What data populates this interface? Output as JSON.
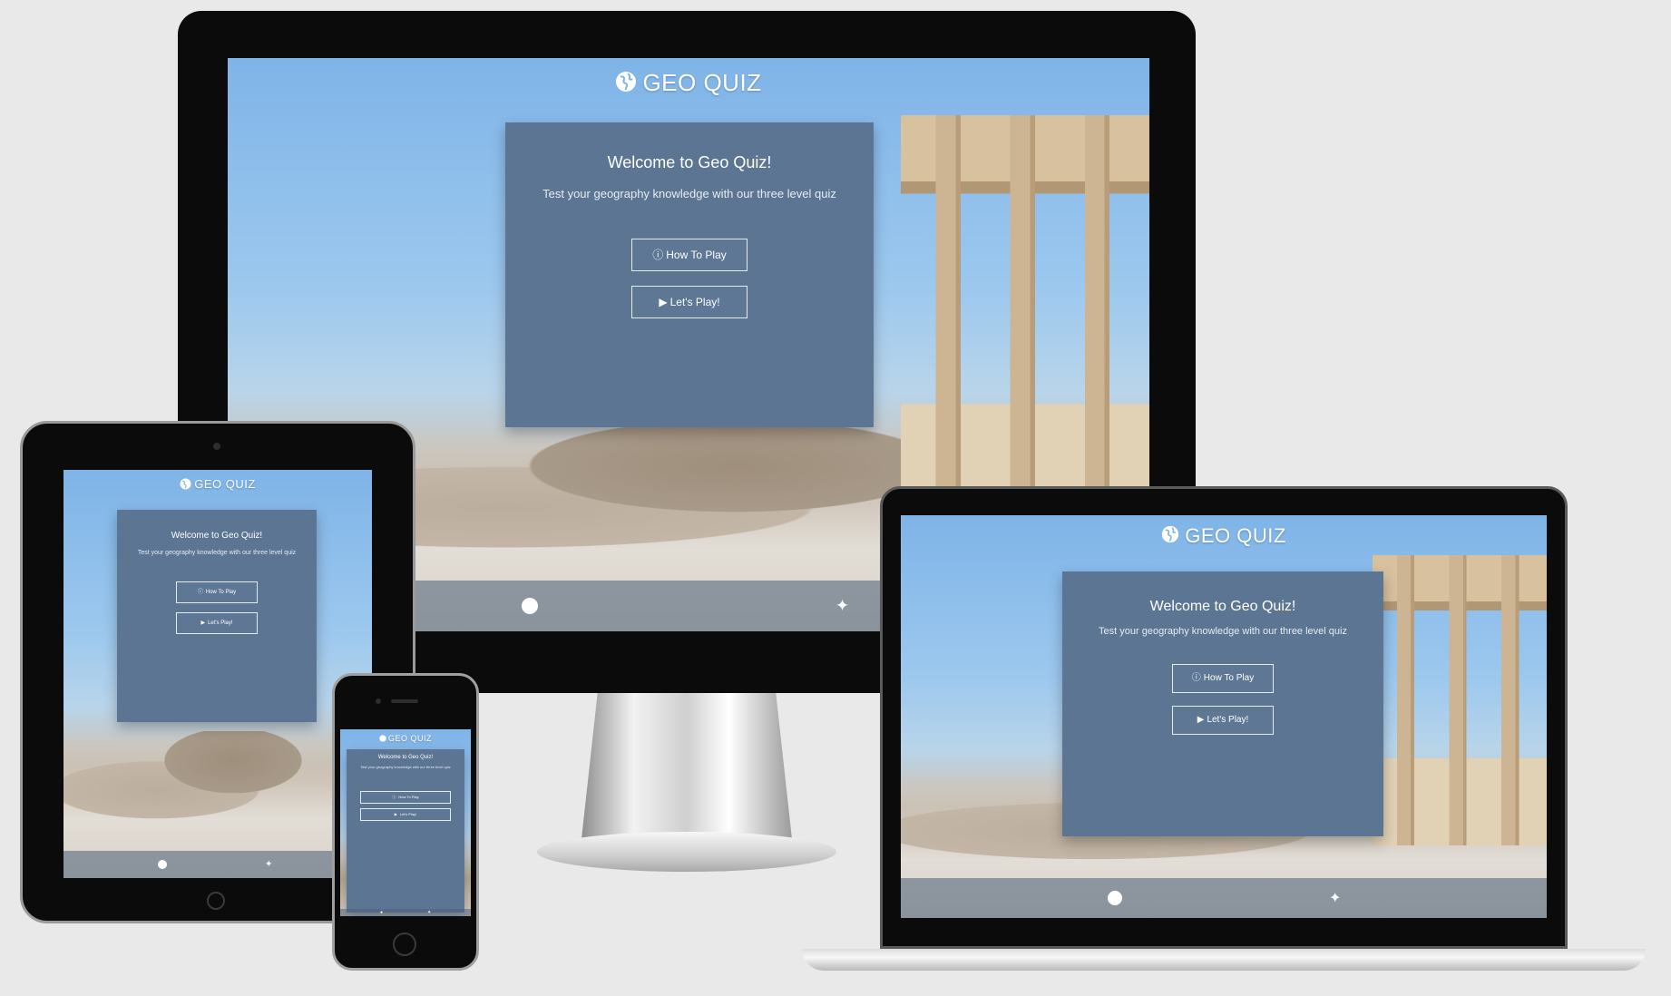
{
  "app": {
    "title": "GEO QUIZ",
    "welcome": "Welcome to Geo Quiz!",
    "subtitle": "Test your geography knowledge with our three level quiz",
    "how_to_play": "How To Play",
    "lets_play": "Let's Play!",
    "icons": {
      "logo": "globe-icon",
      "how_to_play": "question-circle-icon",
      "lets_play": "gamepad-icon",
      "footer_left": "facebook-icon",
      "footer_right": "twitter-icon"
    },
    "colors": {
      "card": "#5b7593",
      "sky": "#7fb4e8",
      "text": "#ffffff"
    }
  }
}
